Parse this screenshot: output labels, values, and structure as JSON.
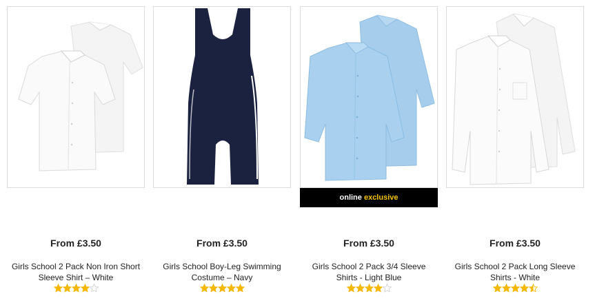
{
  "products": [
    {
      "price": "From £3.50",
      "title_line1": "Girls School 2 Pack Non Iron Short",
      "title_line2": "Sleeve Shirt – White",
      "rating": 4,
      "image": "white-short-sleeve-shirts"
    },
    {
      "price": "From £3.50",
      "title_line1": "Girls School Boy-Leg Swimming",
      "title_line2": "Costume – Navy",
      "rating": 5,
      "image": "navy-swimming-costume"
    },
    {
      "price": "From £3.50",
      "title_line1": "Girls School 2 Pack 3/4 Sleeve",
      "title_line2": "Shirts - Light Blue",
      "rating": 4,
      "image": "light-blue-shirts",
      "badge_prefix": "online",
      "badge_highlight": "exclusive"
    },
    {
      "price": "From £3.50",
      "title_line1": "Girls School 2 Pack Long Sleeve",
      "title_line2": "Shirts - White",
      "rating": 4.5,
      "image": "white-long-sleeve-shirts"
    }
  ],
  "colors": {
    "star_filled": "#f5b800",
    "star_empty": "#cccccc",
    "badge_bg": "#000000",
    "badge_highlight": "#f5c400",
    "navy": "#1b2240",
    "light_blue": "#a9d1ef",
    "shirt_white": "#f7f7f7"
  }
}
